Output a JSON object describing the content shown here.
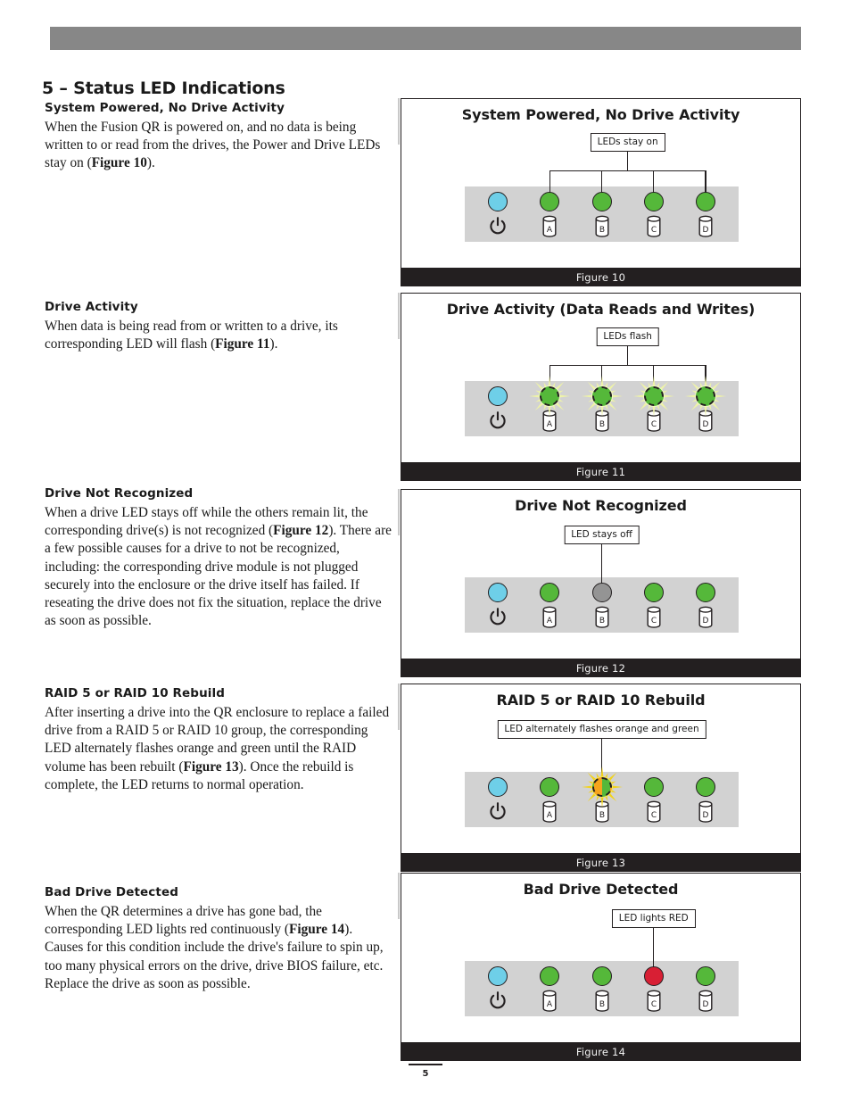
{
  "page": {
    "number": "5",
    "header_bar_color": "#878787",
    "chapter_title": "5 – Status LED Indications"
  },
  "colors": {
    "led_blue": "#6ecfe8",
    "led_green": "#55b83a",
    "led_gray": "#949494",
    "led_red": "#d81f34",
    "led_orange": "#f6a41d",
    "flash_glow": "#e8ef9a",
    "flash_glow_strong": "#f2d31a",
    "panel_gray": "#d2d2d2",
    "caption_bar": "#231f20",
    "ink": "#231f20"
  },
  "sections": [
    {
      "heading": "System Powered, No Drive Activity",
      "body_html": "When the Fusion QR is powered on, and no data is being written to or read from the drives, the Power and Drive LEDs stay on (<b>Figure 10</b>)."
    },
    {
      "heading": "Drive Activity",
      "body_html": "When data is being read from or written to a drive, its corresponding LED will flash (<b>Figure 11</b>)."
    },
    {
      "heading": "Drive Not Recognized",
      "body_html": "When a drive LED stays off while the others remain lit, the corresponding drive(s) is not recognized (<b>Figure 12</b>). There are a few possible causes for a drive to not be recognized, including: the corresponding drive module is not plugged securely into the enclosure or the drive itself has failed. If reseating the drive does not fix the situation, replace the drive as soon as possible."
    },
    {
      "heading": "RAID 5 or RAID 10 Rebuild",
      "body_html": "After inserting a drive into the QR enclosure to replace a failed drive from a RAID 5 or RAID 10 group, the corresponding LED alternately flashes orange and green until the RAID volume has been rebuilt (<b>Figure 13</b>). Once the rebuild is complete, the LED returns to normal operation."
    },
    {
      "heading": "Bad Drive Detected",
      "body_html": "When the QR determines a drive has gone bad, the corresponding LED lights red continuously (<b>Figure 14</b>). Causes for this condition include the drive's failure to spin up, too many physical errors on the drive, drive BIOS failure, etc. Replace the drive as soon as possible."
    }
  ],
  "figures": [
    {
      "title": "System Powered, No Drive Activity",
      "caption": "Figure 10",
      "callout": "LEDs stay on",
      "callout_style": "bracket-four",
      "leds": [
        {
          "icon": "power-icon",
          "label": "",
          "state": "blue"
        },
        {
          "icon": "drive-icon",
          "label": "A",
          "state": "green"
        },
        {
          "icon": "drive-icon",
          "label": "B",
          "state": "green"
        },
        {
          "icon": "drive-icon",
          "label": "C",
          "state": "green"
        },
        {
          "icon": "drive-icon",
          "label": "D",
          "state": "green"
        }
      ]
    },
    {
      "title": "Drive Activity (Data Reads and Writes)",
      "caption": "Figure 11",
      "callout": "LEDs flash",
      "callout_style": "bracket-four",
      "leds": [
        {
          "icon": "power-icon",
          "label": "",
          "state": "blue"
        },
        {
          "icon": "drive-icon",
          "label": "A",
          "state": "green-flash"
        },
        {
          "icon": "drive-icon",
          "label": "B",
          "state": "green-flash"
        },
        {
          "icon": "drive-icon",
          "label": "C",
          "state": "green-flash"
        },
        {
          "icon": "drive-icon",
          "label": "D",
          "state": "green-flash"
        }
      ]
    },
    {
      "title": "Drive Not Recognized",
      "caption": "Figure 12",
      "callout": "LED stays off",
      "callout_style": "single-b",
      "leds": [
        {
          "icon": "power-icon",
          "label": "",
          "state": "blue"
        },
        {
          "icon": "drive-icon",
          "label": "A",
          "state": "green"
        },
        {
          "icon": "drive-icon",
          "label": "B",
          "state": "gray"
        },
        {
          "icon": "drive-icon",
          "label": "C",
          "state": "green"
        },
        {
          "icon": "drive-icon",
          "label": "D",
          "state": "green"
        }
      ]
    },
    {
      "title": "RAID 5 or RAID 10 Rebuild",
      "caption": "Figure 13",
      "callout": "LED alternately flashes orange and green",
      "callout_style": "single-b",
      "leds": [
        {
          "icon": "power-icon",
          "label": "",
          "state": "blue"
        },
        {
          "icon": "drive-icon",
          "label": "A",
          "state": "green"
        },
        {
          "icon": "drive-icon",
          "label": "B",
          "state": "split-flash"
        },
        {
          "icon": "drive-icon",
          "label": "C",
          "state": "green"
        },
        {
          "icon": "drive-icon",
          "label": "D",
          "state": "green"
        }
      ]
    },
    {
      "title": "Bad Drive Detected",
      "caption": "Figure 14",
      "callout": "LED lights RED",
      "callout_style": "single-c",
      "leds": [
        {
          "icon": "power-icon",
          "label": "",
          "state": "blue"
        },
        {
          "icon": "drive-icon",
          "label": "A",
          "state": "green"
        },
        {
          "icon": "drive-icon",
          "label": "B",
          "state": "green"
        },
        {
          "icon": "drive-icon",
          "label": "C",
          "state": "red"
        },
        {
          "icon": "drive-icon",
          "label": "D",
          "state": "green"
        }
      ]
    }
  ]
}
